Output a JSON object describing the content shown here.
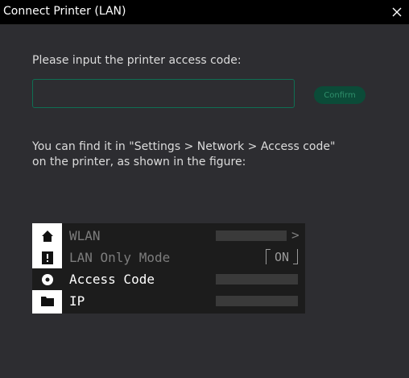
{
  "window": {
    "title": "Connect Printer (LAN)"
  },
  "form": {
    "prompt": "Please input the printer access code:",
    "input_value": "",
    "confirm_label": "Confirm"
  },
  "hint": {
    "line1": "You can find it in \"Settings > Network > Access code\"",
    "line2": "on the printer, as shown in the figure:"
  },
  "figure": {
    "menu": [
      {
        "icon": "home-icon",
        "label": "WLAN",
        "trailing": ">"
      },
      {
        "icon": "lock-icon",
        "label": "LAN Only Mode",
        "trailing": "ON"
      },
      {
        "icon": "gear-icon",
        "label": "Access Code",
        "trailing": ""
      },
      {
        "icon": "folder-icon",
        "label": "IP",
        "trailing": ""
      }
    ]
  },
  "colors": {
    "background": "#2d2d31",
    "titlebar": "#000000",
    "accent": "#0f6f53",
    "confirm_bg": "#0b4b38",
    "confirm_text": "#2f8f6b"
  }
}
